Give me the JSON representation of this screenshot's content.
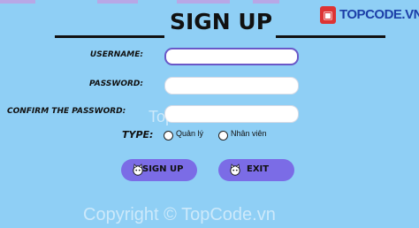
{
  "brand": {
    "logo_text": "TOPCODE.VN"
  },
  "form": {
    "title": "SIGN UP",
    "username_label": "USERNAME:",
    "password_label": "PASSWORD:",
    "confirm_label": "CONFIRM THE PASSWORD:",
    "type_label": "TYPE:",
    "type_options": [
      "Quản lý",
      "Nhân viên"
    ],
    "signup_button": "SIGN UP",
    "exit_button": "EXIT"
  },
  "watermark": {
    "center": "TopCode.vn",
    "bottom": "Copyright © TopCode.vn"
  },
  "colors": {
    "background": "#8fcff5",
    "button": "#7b6ce6",
    "focus_border": "#6a57c7"
  }
}
